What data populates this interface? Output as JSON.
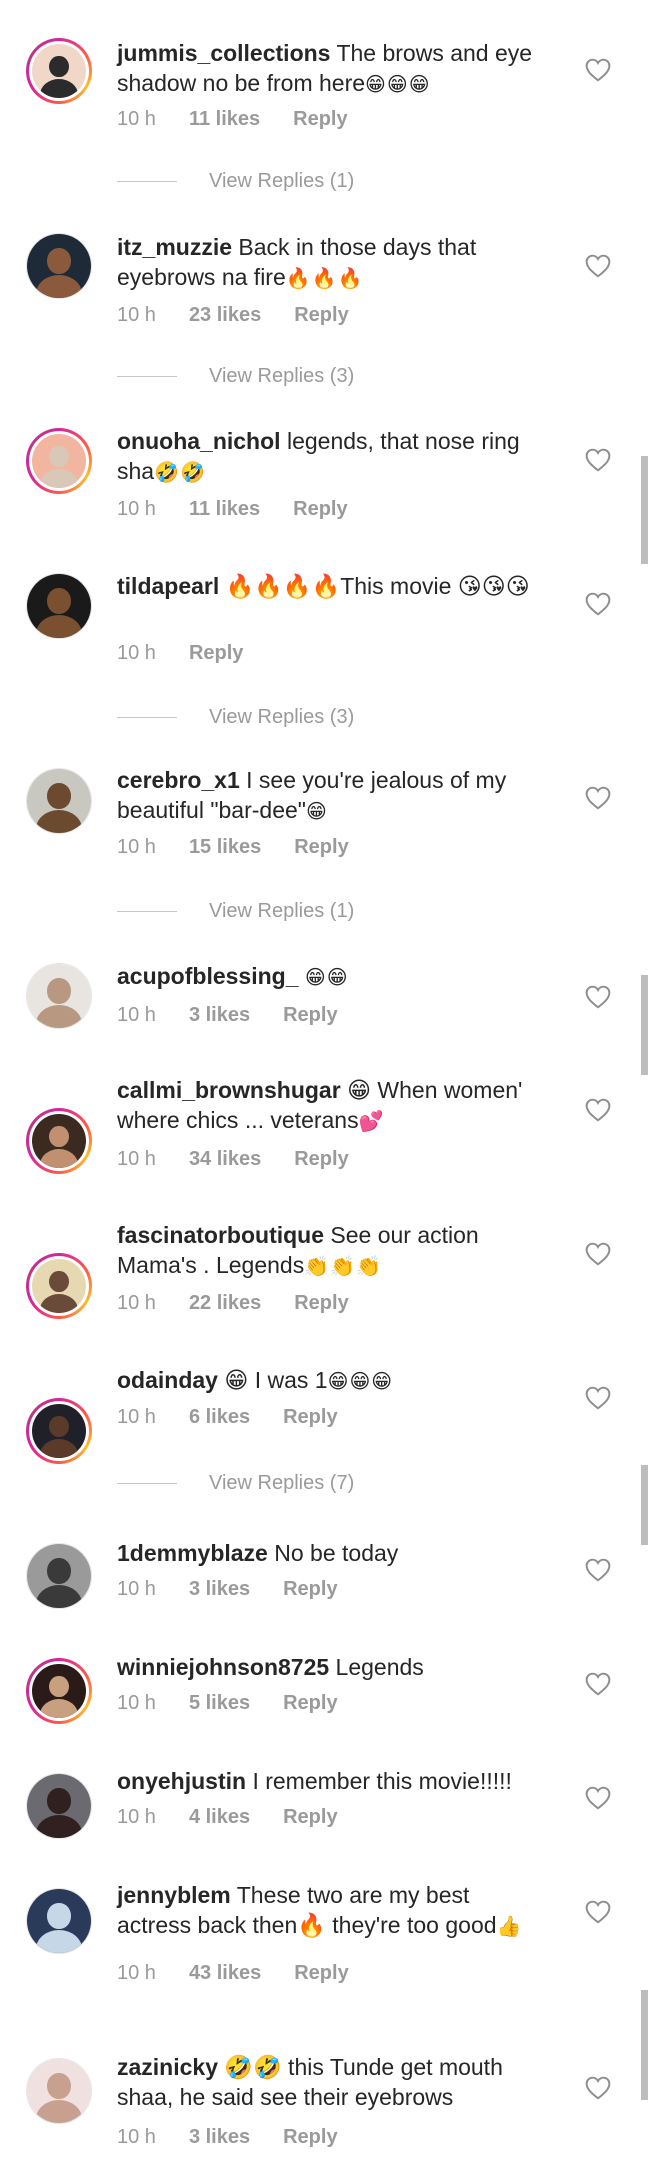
{
  "comments": [
    {
      "username": "jummis_collections",
      "text": "The brows and eye shadow no be from here",
      "emoji": "😁😁😁",
      "time": "10 h",
      "likes": "11 likes",
      "reply": "Reply",
      "story_ring": true,
      "view_replies": "View Replies (1)"
    },
    {
      "username": "itz_muzzie",
      "text": "Back in those days that eyebrows na fire",
      "emoji": "🔥🔥🔥",
      "time": "10 h",
      "likes": "23 likes",
      "reply": "Reply",
      "story_ring": false,
      "view_replies": "View Replies (3)"
    },
    {
      "username": "onuoha_nichol",
      "text": "legends, that nose ring sha",
      "emoji": "🤣🤣",
      "time": "10 h",
      "likes": "11 likes",
      "reply": "Reply",
      "story_ring": true,
      "view_replies": ""
    },
    {
      "username": "tildapearl",
      "text": "🔥🔥🔥🔥This movie 😘😘😘",
      "emoji": "",
      "time": "10 h",
      "likes": "",
      "reply": "Reply",
      "story_ring": false,
      "view_replies": "View Replies (3)"
    },
    {
      "username": "cerebro_x1",
      "text": "I see you're jealous of my beautiful \"bar-dee\"",
      "emoji": "😁",
      "time": "10 h",
      "likes": "15 likes",
      "reply": "Reply",
      "story_ring": false,
      "view_replies": "View Replies (1)"
    },
    {
      "username": "acupofblessing_",
      "text": "",
      "emoji": "😁😁",
      "time": "10 h",
      "likes": "3 likes",
      "reply": "Reply",
      "story_ring": false,
      "view_replies": ""
    },
    {
      "username": "callmi_brownshugar",
      "text": "😁 When women' where chics ... veterans",
      "emoji": "💕",
      "time": "10 h",
      "likes": "34 likes",
      "reply": "Reply",
      "story_ring": true,
      "view_replies": ""
    },
    {
      "username": "fascinatorboutique",
      "text": "See our action Mama's . Legends",
      "emoji": "👏👏👏",
      "time": "10 h",
      "likes": "22 likes",
      "reply": "Reply",
      "story_ring": true,
      "view_replies": ""
    },
    {
      "username": "odainday",
      "text": "😁 I was 1",
      "emoji": "😁😁😁",
      "time": "10 h",
      "likes": "6 likes",
      "reply": "Reply",
      "story_ring": true,
      "view_replies": "View Replies (7)"
    },
    {
      "username": "1demmyblaze",
      "text": "No be today",
      "emoji": "",
      "time": "10 h",
      "likes": "3 likes",
      "reply": "Reply",
      "story_ring": false,
      "view_replies": ""
    },
    {
      "username": "winniejohnson8725",
      "text": "Legends",
      "emoji": "",
      "time": "10 h",
      "likes": "5 likes",
      "reply": "Reply",
      "story_ring": true,
      "view_replies": ""
    },
    {
      "username": "onyehjustin",
      "text": "I remember this movie!!!!!",
      "emoji": "",
      "time": "10 h",
      "likes": "4 likes",
      "reply": "Reply",
      "story_ring": false,
      "view_replies": ""
    },
    {
      "username": "jennyblem",
      "text": "These two are my best actress back then🔥 they're too good",
      "emoji": "👍",
      "time": "10 h",
      "likes": "43 likes",
      "reply": "Reply",
      "story_ring": false,
      "view_replies": ""
    },
    {
      "username": "zazinicky",
      "text": "🤣🤣 this Tunde get mouth shaa, he said see their eyebrows",
      "emoji": "",
      "time": "10 h",
      "likes": "3 likes",
      "reply": "Reply",
      "story_ring": false,
      "view_replies": ""
    }
  ],
  "colors": {
    "username": "#262626",
    "meta": "#9a9a9a",
    "story_ring": [
      "#d6249f",
      "#fd5949",
      "#fdbf2d"
    ]
  },
  "icons": {
    "like": "heart-outline-icon"
  }
}
